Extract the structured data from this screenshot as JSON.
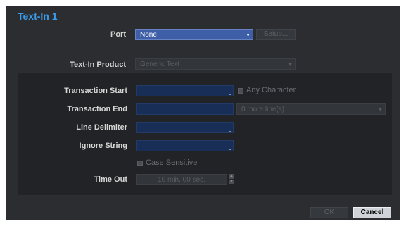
{
  "dialog": {
    "title": "Text-In 1"
  },
  "port": {
    "label": "Port",
    "value": "None",
    "setup_label": "Setup..."
  },
  "product": {
    "label": "Text-In Product",
    "value": "Generic Text"
  },
  "transaction_start": {
    "label": "Transaction Start",
    "value": ""
  },
  "any_character": {
    "label": "Any Character",
    "checked": false
  },
  "transaction_end": {
    "label": "Transaction End",
    "value": "",
    "lines_value": "0 more line(s)"
  },
  "line_delimiter": {
    "label": "Line Delimiter",
    "value": ""
  },
  "ignore_string": {
    "label": "Ignore String",
    "value": ""
  },
  "case_sensitive": {
    "label": "Case Sensitive",
    "checked": false
  },
  "time_out": {
    "label": "Time Out",
    "value": "10 min. 00 sec."
  },
  "buttons": {
    "ok": "OK",
    "cancel": "Cancel"
  },
  "colors": {
    "accent": "#3a9bea",
    "field": "#182e57",
    "select_active": "#3f5ea8"
  }
}
